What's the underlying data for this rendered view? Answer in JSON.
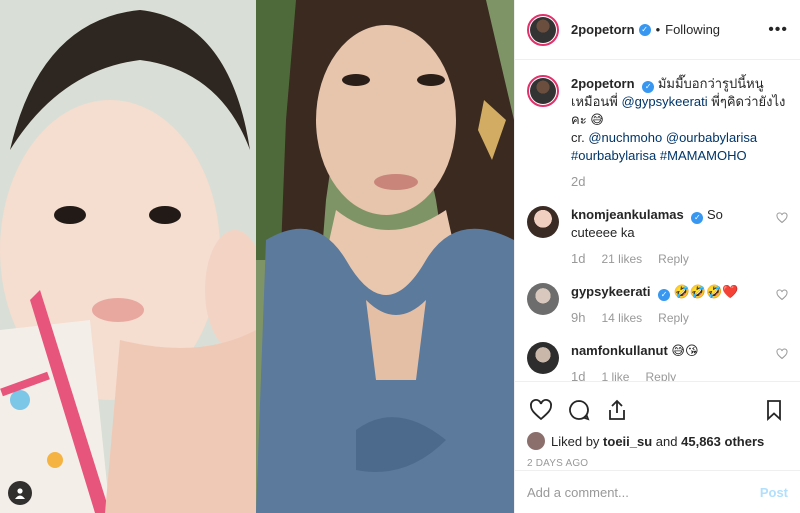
{
  "post": {
    "username": "2popetorn",
    "follow_state": "Following",
    "more_icon": "more-options-icon"
  },
  "caption": {
    "username": "2popetorn",
    "text_before": "มัมมี๊บอกว่ารูปนี้หนูเหมือนพี่ ",
    "mention_1": "@gypsykeerati",
    "text_middle": " พี่ๆคิดว่ายังไงคะ 😅",
    "credit_prefix": "cr. ",
    "mention_2": "@nuchmoho",
    "mention_3": "@ourbabylarisa",
    "hashtag_1": "#ourbabylarisa",
    "hashtag_2": "#MAMAMOHO",
    "age": "2d"
  },
  "comments": [
    {
      "user": "knomjeankulamas",
      "text": "So cuteeee ka",
      "age": "1d",
      "likes": "21 likes",
      "reply": "Reply"
    },
    {
      "user": "gypsykeerati",
      "text": "🤣🤣🤣❤️",
      "age": "9h",
      "likes": "14 likes",
      "reply": "Reply"
    },
    {
      "user": "namfonkullanut",
      "text": "😅😘",
      "age": "1d",
      "likes": "1 like",
      "reply": "Reply"
    }
  ],
  "likes": {
    "prefix": "Liked by ",
    "user": "toeii_su",
    "middle": " and ",
    "count": "45,863 others"
  },
  "timestamp": "2 DAYS AGO",
  "add_comment": {
    "placeholder": "Add a comment...",
    "post_label": "Post"
  },
  "colors": {
    "accent": "#3897f0",
    "link": "#003569",
    "meta": "#999999",
    "border": "#efefef"
  }
}
